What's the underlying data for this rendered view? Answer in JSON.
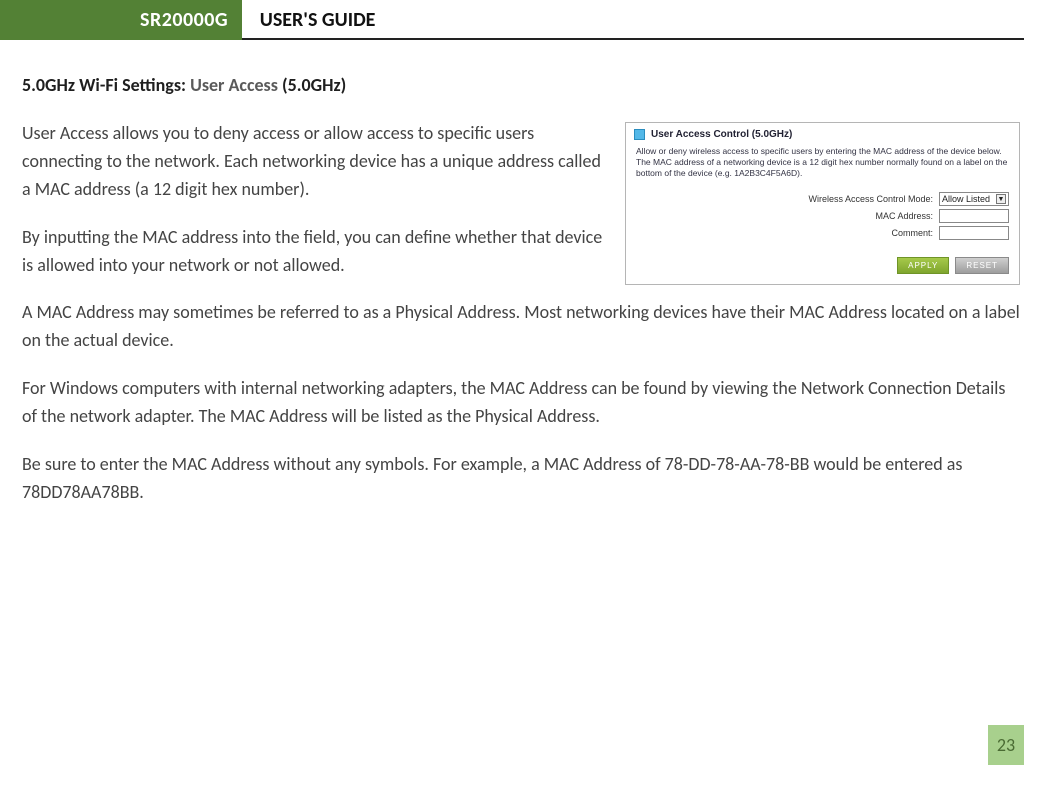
{
  "header": {
    "product": "SR20000G",
    "guide": "USER'S GUIDE"
  },
  "section": {
    "prefix": "5.0GHz Wi-Fi Settings: ",
    "name": "User Access",
    "suffix": " (5.0GHz)"
  },
  "paragraphs": {
    "p1": "User Access allows you to deny access or allow access to specific users connecting to the network. Each networking device has a unique address called a MAC address (a 12 digit hex number).",
    "p2": "By inputting the MAC address into the field, you can define whether that device is allowed into your network or not allowed.",
    "p3": "A MAC Address may sometimes be referred to as a Physical Address. Most networking devices have their MAC Address located on a label on the actual device.",
    "p4": "For Windows computers with internal networking adapters, the MAC Address can be found by viewing the Network Connection Details of the network adapter. The MAC Address will be listed as the Physical Address.",
    "p5": "Be sure to enter the MAC Address without any symbols. For example, a MAC Address of 78-DD-78-AA-78-BB would be entered as 78DD78AA78BB."
  },
  "panel": {
    "title": "User Access Control (5.0GHz)",
    "desc": "Allow or deny wireless access to specific users by entering the MAC address of the device below. The MAC address of a networking device is a 12 digit hex number normally found on a label on the bottom of the device (e.g. 1A2B3C4F5A6D).",
    "rows": {
      "mode_label": "Wireless Access Control Mode:",
      "mode_value": "Allow Listed",
      "mac_label": "MAC Address:",
      "comment_label": "Comment:"
    },
    "buttons": {
      "apply": "APPLY",
      "reset": "RESET"
    }
  },
  "page_number": "23"
}
